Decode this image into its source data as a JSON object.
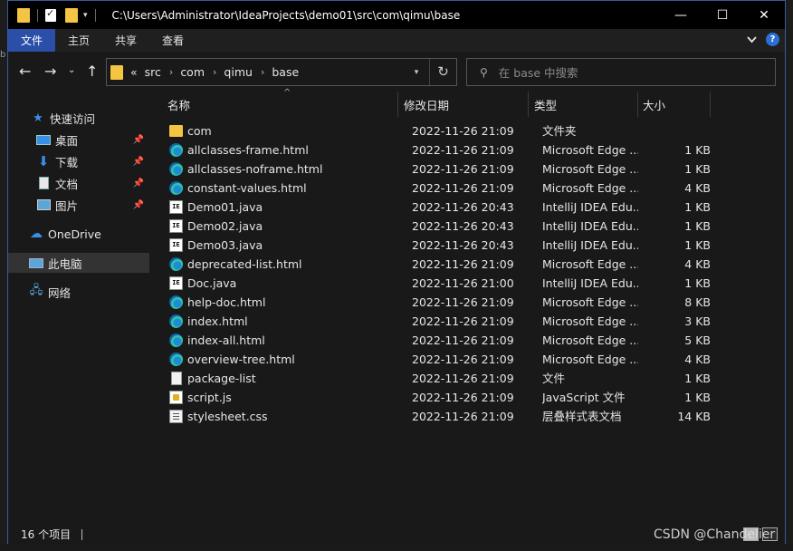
{
  "window": {
    "path": "C:\\Users\\Administrator\\IdeaProjects\\demo01\\src\\com\\qimu\\base",
    "controls": {
      "minimize": "—",
      "maximize": "☐",
      "close": "✕"
    }
  },
  "ribbon": {
    "tabs": [
      {
        "label": "文件",
        "active": true
      },
      {
        "label": "主页"
      },
      {
        "label": "共享"
      },
      {
        "label": "查看"
      }
    ]
  },
  "navigation": {
    "back": "←",
    "forward": "→",
    "dropdown": "⌄",
    "up": "↑",
    "breadcrumb_prefix": "«",
    "breadcrumbs": [
      "src",
      "com",
      "qimu",
      "base"
    ],
    "search_placeholder": "在 base 中搜索"
  },
  "sidebar": {
    "items": [
      {
        "label": "快速访问",
        "icon": "star-icon"
      },
      {
        "label": "桌面",
        "icon": "desktop-icon",
        "pinned": true
      },
      {
        "label": "下载",
        "icon": "download-icon",
        "pinned": true
      },
      {
        "label": "文档",
        "icon": "documents-icon",
        "pinned": true
      },
      {
        "label": "图片",
        "icon": "pictures-icon",
        "pinned": true
      },
      {
        "label": "OneDrive",
        "icon": "cloud-icon"
      },
      {
        "label": "此电脑",
        "icon": "computer-icon",
        "selected": true
      },
      {
        "label": "网络",
        "icon": "network-icon"
      }
    ]
  },
  "columns": {
    "name": "名称",
    "date": "修改日期",
    "type": "类型",
    "size": "大小"
  },
  "files": [
    {
      "name": "com",
      "date": "2022-11-26 21:09",
      "type": "文件夹",
      "size": "",
      "icon": "folder"
    },
    {
      "name": "allclasses-frame.html",
      "date": "2022-11-26 21:09",
      "type": "Microsoft Edge ...",
      "size": "1 KB",
      "icon": "edge"
    },
    {
      "name": "allclasses-noframe.html",
      "date": "2022-11-26 21:09",
      "type": "Microsoft Edge ...",
      "size": "1 KB",
      "icon": "edge"
    },
    {
      "name": "constant-values.html",
      "date": "2022-11-26 21:09",
      "type": "Microsoft Edge ...",
      "size": "4 KB",
      "icon": "edge"
    },
    {
      "name": "Demo01.java",
      "date": "2022-11-26 20:43",
      "type": "IntelliJ IDEA Edu...",
      "size": "1 KB",
      "icon": "java"
    },
    {
      "name": "Demo02.java",
      "date": "2022-11-26 20:43",
      "type": "IntelliJ IDEA Edu...",
      "size": "1 KB",
      "icon": "java"
    },
    {
      "name": "Demo03.java",
      "date": "2022-11-26 20:43",
      "type": "IntelliJ IDEA Edu...",
      "size": "1 KB",
      "icon": "java"
    },
    {
      "name": "deprecated-list.html",
      "date": "2022-11-26 21:09",
      "type": "Microsoft Edge ...",
      "size": "4 KB",
      "icon": "edge"
    },
    {
      "name": "Doc.java",
      "date": "2022-11-26 21:00",
      "type": "IntelliJ IDEA Edu...",
      "size": "1 KB",
      "icon": "java"
    },
    {
      "name": "help-doc.html",
      "date": "2022-11-26 21:09",
      "type": "Microsoft Edge ...",
      "size": "8 KB",
      "icon": "edge"
    },
    {
      "name": "index.html",
      "date": "2022-11-26 21:09",
      "type": "Microsoft Edge ...",
      "size": "3 KB",
      "icon": "edge"
    },
    {
      "name": "index-all.html",
      "date": "2022-11-26 21:09",
      "type": "Microsoft Edge ...",
      "size": "5 KB",
      "icon": "edge"
    },
    {
      "name": "overview-tree.html",
      "date": "2022-11-26 21:09",
      "type": "Microsoft Edge ...",
      "size": "4 KB",
      "icon": "edge"
    },
    {
      "name": "package-list",
      "date": "2022-11-26 21:09",
      "type": "文件",
      "size": "1 KB",
      "icon": "file"
    },
    {
      "name": "script.js",
      "date": "2022-11-26 21:09",
      "type": "JavaScript 文件",
      "size": "1 KB",
      "icon": "js"
    },
    {
      "name": "stylesheet.css",
      "date": "2022-11-26 21:09",
      "type": "层叠样式表文档",
      "size": "14 KB",
      "icon": "css"
    }
  ],
  "status": {
    "count": "16 个项目"
  },
  "watermark": "CSDN @Chandelier",
  "accent_color": "#2b4fa8"
}
